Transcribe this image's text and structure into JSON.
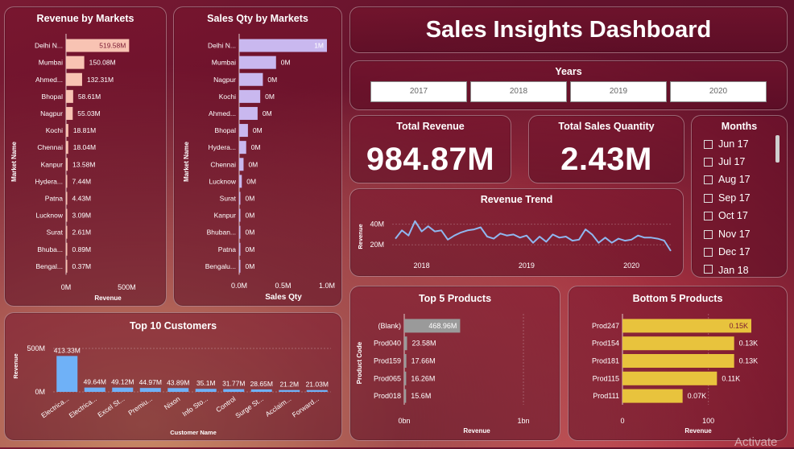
{
  "dashboard": {
    "title": "Sales Insights Dashboard",
    "years_title": "Years",
    "years": [
      "2017",
      "2018",
      "2019",
      "2020"
    ],
    "kpis": {
      "revenue_label": "Total Revenue",
      "revenue_value": "984.87M",
      "qty_label": "Total Sales Quantity",
      "qty_value": "2.43M"
    },
    "months_title": "Months",
    "months": [
      "Jun 17",
      "Jul 17",
      "Aug 17",
      "Sep 17",
      "Oct 17",
      "Nov 17",
      "Dec 17",
      "Jan 18"
    ],
    "watermark": "Activate"
  },
  "colors": {
    "revenue_bar": "#f8c3b3",
    "qty_bar": "#c9b8ef",
    "customer_bar": "#6fb1f7",
    "top_product_bar": "#9a9a9a",
    "bottom_product_bar": "#e8c33d",
    "trend_line": "#8fb7ef"
  },
  "chart_data": [
    {
      "type": "bar",
      "orientation": "horizontal",
      "title": "Revenue by Markets",
      "ylabel": "Market Name",
      "xlabel": "Revenue",
      "categories": [
        "Delhi N...",
        "Mumbai",
        "Ahmed...",
        "Bhopal",
        "Nagpur",
        "Kochi",
        "Chennai",
        "Kanpur",
        "Hydera...",
        "Patna",
        "Lucknow",
        "Surat",
        "Bhuba...",
        "Bengal..."
      ],
      "values": [
        519.58,
        150.08,
        132.31,
        58.61,
        55.03,
        18.81,
        18.04,
        13.58,
        7.44,
        4.43,
        3.09,
        2.61,
        0.89,
        0.37
      ],
      "data_labels": [
        "519.58M",
        "150.08M",
        "132.31M",
        "58.61M",
        "55.03M",
        "18.81M",
        "18.04M",
        "13.58M",
        "7.44M",
        "4.43M",
        "3.09M",
        "2.61M",
        "0.89M",
        "0.37M"
      ],
      "xticks": [
        "0M",
        "500M"
      ],
      "xtick_values": [
        0,
        500
      ],
      "xlim": [
        0,
        610
      ]
    },
    {
      "type": "bar",
      "orientation": "horizontal",
      "title": "Sales Qty by Markets",
      "ylabel": "Market Name",
      "xlabel": "Sales Qty",
      "categories": [
        "Delhi N...",
        "Mumbai",
        "Nagpur",
        "Kochi",
        "Ahmed...",
        "Bhopal",
        "Hydera...",
        "Chennai",
        "Lucknow",
        "Surat",
        "Kanpur",
        "Bhuban...",
        "Patna",
        "Bengalu..."
      ],
      "values": [
        1.0,
        0.42,
        0.27,
        0.24,
        0.21,
        0.1,
        0.08,
        0.05,
        0.03,
        0.01,
        0.01,
        0.003,
        0.002,
        0.001
      ],
      "data_labels": [
        "1M",
        "0M",
        "0M",
        "0M",
        "0M",
        "0M",
        "0M",
        "0M",
        "0M",
        "0M",
        "0M",
        "0M",
        "0M",
        "0M"
      ],
      "xticks": [
        "0.0M",
        "0.5M",
        "1.0M"
      ],
      "xtick_values": [
        0,
        0.5,
        1.0
      ],
      "xlim": [
        0,
        1.0
      ]
    },
    {
      "type": "bar",
      "orientation": "vertical",
      "title": "Top 10 Customers",
      "xlabel": "Customer Name",
      "ylabel": "Revenue",
      "categories": [
        "Electrica...",
        "Electrica...",
        "Excel St...",
        "Premiu...",
        "Nixon",
        "Info Sto...",
        "Control",
        "Surge St...",
        "Acclaim...",
        "Forward..."
      ],
      "values": [
        413.33,
        49.64,
        49.12,
        44.97,
        43.89,
        35.1,
        31.77,
        28.65,
        21.2,
        21.03
      ],
      "data_labels": [
        "413.33M",
        "49.64M",
        "49.12M",
        "44.97M",
        "43.89M",
        "35.1M",
        "31.77M",
        "28.65M",
        "21.2M",
        "21.03M"
      ],
      "yticks": [
        "0M",
        "500M"
      ],
      "ytick_values": [
        0,
        500
      ],
      "ylim": [
        0,
        500
      ]
    },
    {
      "type": "line",
      "title": "Revenue Trend",
      "ylabel": "Revenue",
      "x_start": "2017-10",
      "values": [
        26,
        34,
        29,
        43,
        33,
        38,
        33,
        34,
        25,
        29,
        32,
        34,
        35,
        37,
        28,
        26,
        31,
        29,
        30,
        27,
        29,
        22,
        28,
        23,
        30,
        27,
        28,
        24,
        25,
        35,
        30,
        22,
        27,
        22,
        26,
        24,
        25,
        29,
        27,
        27,
        26,
        24,
        14
      ],
      "xticks": [
        "2018",
        "2019",
        "2020"
      ],
      "xtick_index": [
        4,
        20,
        36
      ],
      "yticks": [
        "20M",
        "40M"
      ],
      "ytick_values": [
        20,
        40
      ],
      "ylim": [
        10,
        46
      ]
    },
    {
      "type": "bar",
      "orientation": "horizontal",
      "title": "Top 5 Products",
      "ylabel": "Product Code",
      "xlabel": "Revenue",
      "categories": [
        "(Blank)",
        "Prod040",
        "Prod159",
        "Prod065",
        "Prod018"
      ],
      "values": [
        468.96,
        23.58,
        17.66,
        16.26,
        15.6
      ],
      "data_labels": [
        "468.96M",
        "23.58M",
        "17.66M",
        "16.26M",
        "15.6M"
      ],
      "xticks": [
        "0bn",
        "1bn"
      ],
      "xtick_values": [
        0,
        1000
      ],
      "xlim": [
        0,
        1000
      ]
    },
    {
      "type": "bar",
      "orientation": "horizontal",
      "title": "Bottom 5 Products",
      "xlabel": "Revenue",
      "categories": [
        "Prod247",
        "Prod154",
        "Prod181",
        "Prod115",
        "Prod111"
      ],
      "values": [
        0.15,
        0.13,
        0.13,
        0.11,
        0.07
      ],
      "data_labels": [
        "0.15K",
        "0.13K",
        "0.13K",
        "0.11K",
        "0.07K"
      ],
      "xticks": [
        "0",
        "100"
      ],
      "xtick_values": [
        0,
        100
      ],
      "xlim": [
        0,
        165
      ],
      "display_scale": 1000
    }
  ]
}
